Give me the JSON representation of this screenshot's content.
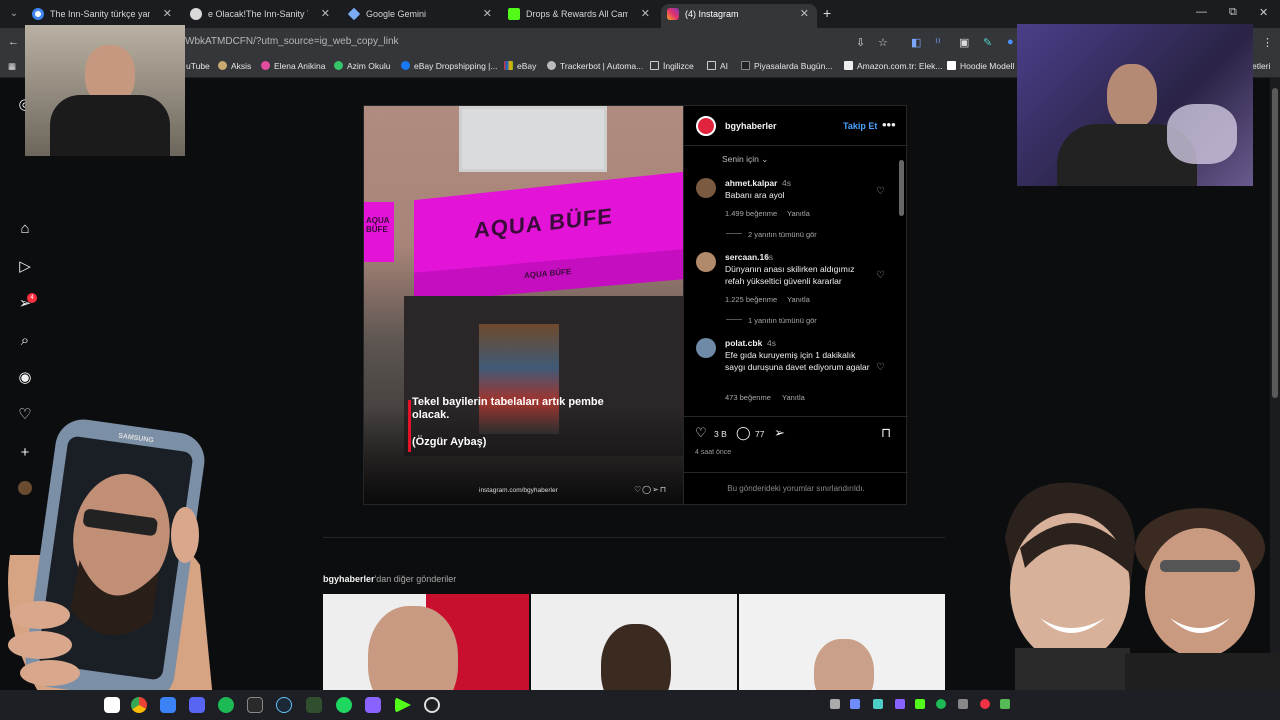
{
  "tabs": [
    {
      "label": "The Inn-Sanity türkçe yama - G",
      "icon": "google-icon",
      "active": false
    },
    {
      "label": "e Olacak!The Inn-Sanity Türkçe",
      "icon": "globe-icon",
      "active": false
    },
    {
      "label": "Google Gemini",
      "icon": "gemini-icon",
      "active": false
    },
    {
      "label": "Drops & Rewards All Campaign",
      "icon": "kick-icon",
      "active": false
    },
    {
      "label": "(4) Instagram",
      "icon": "instagram-icon",
      "active": true
    }
  ],
  "address": {
    "url": "WbkATMDCFN/?utm_source=ig_web_copy_link"
  },
  "bookmarks": [
    "uTube",
    "Aksis",
    "Elena Anikina",
    "Azim Okulu",
    "eBay Dropshipping |...",
    "eBay",
    "Trackerbot | Automa...",
    "İngilizce",
    "AI",
    "Piyasalarda Bugün...",
    "Amazon.com.tr: Elek...",
    "Hoodie Modell",
    "etleri"
  ],
  "sidebar": {
    "notifications_badge": "4"
  },
  "post": {
    "username": "bgyhaberler",
    "follow_label": "Takip Et",
    "more_label": "•••",
    "image": {
      "shop_sign": "AQUA BÜFE",
      "awning_sign": "AQUA BÜFE",
      "side_sign": "AQUA BÜFE",
      "caption": "Tekel bayilerin tabelaları artık pembe olacak.",
      "author": "(Özgür Aybaş)",
      "watermark": "instagram.com/bgyhaberler"
    },
    "sort_label": "Senin için",
    "comments": [
      {
        "user": "ahmet.kalpar",
        "time": "4s",
        "text": "Babanı ara ayol",
        "likes": "1.499 beğenme",
        "reply": "Yanıtla",
        "replies": "2 yanıtın tümünü gör",
        "avatar_color": "#7a5a40"
      },
      {
        "user": "sercaan.16",
        "time": "4s",
        "text": "Dünyanın anası skilirken aldıgımız refah yükseltici güvenli kararlar",
        "likes": "1.225 beğenme",
        "reply": "Yanıtla",
        "replies": "1 yanıtın tümünü gör",
        "avatar_color": "#b08a6a"
      },
      {
        "user": "polat.cbk",
        "time": "4s",
        "text": "Efe gıda kuruyemiş için 1 dakikalık saygı duruşuna davet ediyorum agalar",
        "likes": "473 beğenme",
        "reply": "Yanıtla",
        "avatar_color": "#6f8aa6"
      }
    ],
    "like_count": "3 B",
    "comment_count": "77",
    "time_ago": "4 saat önce",
    "comments_limited": "Bu gönderideki yorumlar sınırlandırıldı."
  },
  "more_posts": {
    "prefix": "bgyhaberler",
    "suffix": "'dan diğer gönderiler"
  },
  "phone_brand": "SAMSUNG",
  "colors": {
    "accent": "#4aa3ff",
    "sign_pink": "#e313d8",
    "badge": "#ff3040"
  }
}
